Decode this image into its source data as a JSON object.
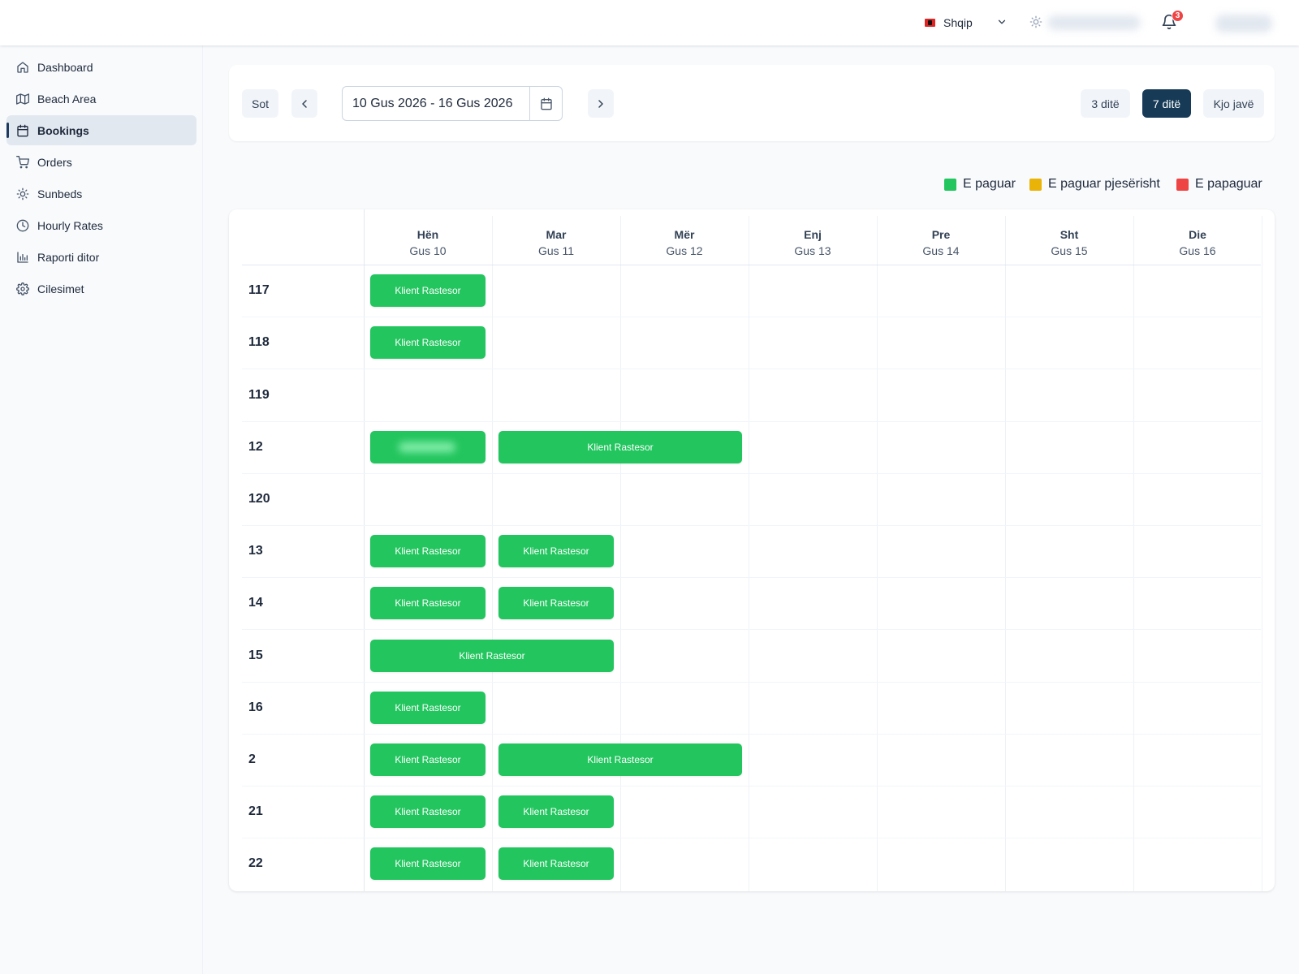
{
  "header": {
    "language": "Shqip",
    "notification_count": "3"
  },
  "sidebar": {
    "items": [
      {
        "label": "Dashboard",
        "icon": "home-icon"
      },
      {
        "label": "Beach Area",
        "icon": "map-icon"
      },
      {
        "label": "Bookings",
        "icon": "calendar-icon",
        "active": true
      },
      {
        "label": "Orders",
        "icon": "cart-icon"
      },
      {
        "label": "Sunbeds",
        "icon": "sun-icon"
      },
      {
        "label": "Hourly Rates",
        "icon": "clock-icon"
      },
      {
        "label": "Raporti ditor",
        "icon": "bar-chart-icon"
      },
      {
        "label": "Cilesimet",
        "icon": "gear-icon"
      }
    ]
  },
  "toolbar": {
    "today_label": "Sot",
    "date_range": "10 Gus 2026 - 16 Gus 2026",
    "view_3_days": "3 ditë",
    "view_7_days": "7 ditë",
    "view_this_week": "Kjo javë",
    "active_view": "7 ditë"
  },
  "legend": [
    {
      "label": "E paguar",
      "color": "#22c55e"
    },
    {
      "label": "E paguar pjesërisht",
      "color": "#eab308"
    },
    {
      "label": "E papaguar",
      "color": "#ef4444"
    }
  ],
  "calendar": {
    "days": [
      {
        "name": "Hën",
        "date": "Gus 10"
      },
      {
        "name": "Mar",
        "date": "Gus 11"
      },
      {
        "name": "Mër",
        "date": "Gus 12"
      },
      {
        "name": "Enj",
        "date": "Gus 13"
      },
      {
        "name": "Pre",
        "date": "Gus 14"
      },
      {
        "name": "Sht",
        "date": "Gus 15"
      },
      {
        "name": "Die",
        "date": "Gus 16"
      }
    ],
    "rows": [
      {
        "label": "117",
        "bookings": [
          {
            "start": 0,
            "span": 1,
            "text": "Klient Rastesor",
            "status": "paid"
          }
        ]
      },
      {
        "label": "118",
        "bookings": [
          {
            "start": 0,
            "span": 1,
            "text": "Klient Rastesor",
            "status": "paid"
          }
        ]
      },
      {
        "label": "119",
        "bookings": []
      },
      {
        "label": "12",
        "bookings": [
          {
            "start": 0,
            "span": 1,
            "text": "",
            "status": "paid",
            "redacted": true
          },
          {
            "start": 1,
            "span": 2,
            "text": "Klient Rastesor",
            "status": "paid"
          }
        ]
      },
      {
        "label": "120",
        "bookings": []
      },
      {
        "label": "13",
        "bookings": [
          {
            "start": 0,
            "span": 1,
            "text": "Klient Rastesor",
            "status": "paid"
          },
          {
            "start": 1,
            "span": 1,
            "text": "Klient Rastesor",
            "status": "paid"
          }
        ]
      },
      {
        "label": "14",
        "bookings": [
          {
            "start": 0,
            "span": 1,
            "text": "Klient Rastesor",
            "status": "paid"
          },
          {
            "start": 1,
            "span": 1,
            "text": "Klient Rastesor",
            "status": "paid"
          }
        ]
      },
      {
        "label": "15",
        "bookings": [
          {
            "start": 0,
            "span": 2,
            "text": "Klient Rastesor",
            "status": "paid"
          }
        ]
      },
      {
        "label": "16",
        "bookings": [
          {
            "start": 0,
            "span": 1,
            "text": "Klient Rastesor",
            "status": "paid"
          }
        ]
      },
      {
        "label": "2",
        "bookings": [
          {
            "start": 0,
            "span": 1,
            "text": "Klient Rastesor",
            "status": "paid"
          },
          {
            "start": 1,
            "span": 2,
            "text": "Klient Rastesor",
            "status": "paid"
          }
        ]
      },
      {
        "label": "21",
        "bookings": [
          {
            "start": 0,
            "span": 1,
            "text": "Klient Rastesor",
            "status": "paid"
          },
          {
            "start": 1,
            "span": 1,
            "text": "Klient Rastesor",
            "status": "paid"
          }
        ]
      },
      {
        "label": "22",
        "bookings": [
          {
            "start": 0,
            "span": 1,
            "text": "Klient Rastesor",
            "status": "paid"
          },
          {
            "start": 1,
            "span": 1,
            "text": "Klient Rastesor",
            "status": "paid"
          }
        ]
      }
    ]
  },
  "colors": {
    "paid": "#22c55e",
    "partial": "#eab308",
    "unpaid": "#ef4444",
    "primary": "#173b57"
  }
}
